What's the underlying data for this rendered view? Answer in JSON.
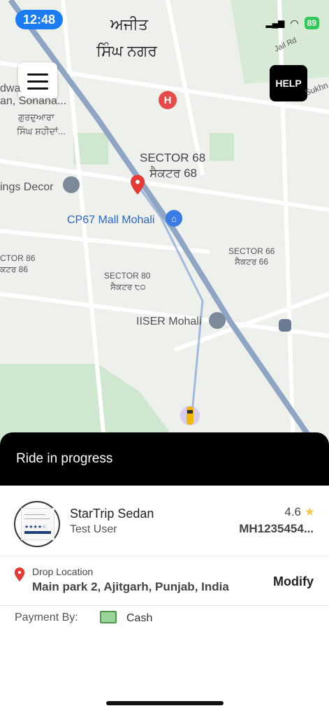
{
  "status_bar": {
    "time": "12:48",
    "battery": "89"
  },
  "map": {
    "labels": {
      "top_punjabi_1": "ਅਜੀਤ",
      "top_punjabi_2": "ਸਿੰਘ ਨਗਰ",
      "gurudwara_en": "dwa\nan, Sonana...",
      "gurudwara_pa_1": "ਗੁਰਦੁਆਰਾ",
      "gurudwara_pa_2": "ਸਿੰਘ ਸ਼ਹੀਦਾਂ...",
      "sector68_en": "SECTOR 68",
      "sector68_pa": "ਸੈਕਟਰ 68",
      "decor": "ings Decor",
      "cp67": "CP67 Mall Mohali",
      "sector86_en": "CTOR 86",
      "sector86_pa": "ਕਟਰ 86",
      "sector80_en": "SECTOR 80",
      "sector80_pa": "ਸੈਕਟਰ ੮੦",
      "sector66_en": "SECTOR 66",
      "sector66_pa": "ਸੈਕਟਰ 66",
      "iiser": "IISER Mohali",
      "jail_rd": "Jail Rd",
      "sukhna": "Sukhn"
    },
    "menu_icon": "hamburger-icon",
    "help_label": "HELP"
  },
  "ride": {
    "status": "Ride in progress",
    "car_name": "StarTrip Sedan",
    "driver_name": "Test User",
    "rating": "4.6",
    "plate": "MH1235454...",
    "drop_title": "Drop Location",
    "drop_address": "Main park 2, Ajitgarh, Punjab, India",
    "modify_label": "Modify",
    "payment_label": "Payment By:",
    "payment_method": "Cash"
  },
  "colors": {
    "accent": "#1a7cf0",
    "pin": "#e53935",
    "road": "#8fa5c4"
  }
}
